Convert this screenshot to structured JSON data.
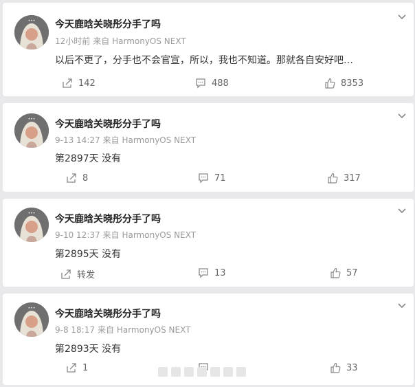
{
  "posts": [
    {
      "username": "今天鹿晗关晓彤分手了吗",
      "time": "12小时前",
      "source": "来自 HarmonyOS NEXT",
      "text": "以后不更了，分手也不会官宣，所以，我也不知道。那就各自安好吧…",
      "repost": "142",
      "comments": "488",
      "likes": "8353"
    },
    {
      "username": "今天鹿晗关晓彤分手了吗",
      "time": "9-13 14:27",
      "source": "来自 HarmonyOS NEXT",
      "text": "第2897天 没有",
      "repost": "8",
      "comments": "71",
      "likes": "317"
    },
    {
      "username": "今天鹿晗关晓彤分手了吗",
      "time": "9-10 12:37",
      "source": "来自 HarmonyOS NEXT",
      "text": "第2895天 没有",
      "repost": "转发",
      "comments": "13",
      "likes": "57"
    },
    {
      "username": "今天鹿晗关晓彤分手了吗",
      "time": "9-8 18:17",
      "source": "来自 HarmonyOS NEXT",
      "text": "第2893天 没有",
      "repost": "1",
      "comments": "",
      "likes": "33"
    }
  ],
  "colors": {
    "background": "#e9e9eb",
    "card": "#ffffff",
    "meta": "#9a9a9a",
    "icon": "#888888"
  }
}
